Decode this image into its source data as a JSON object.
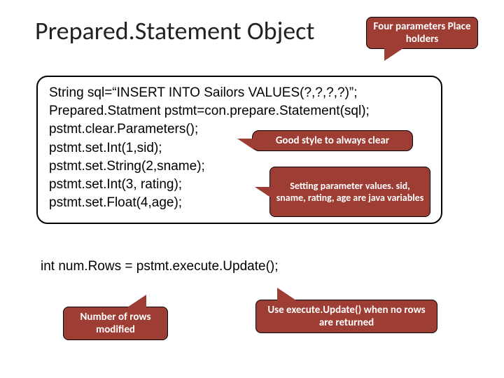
{
  "title": "Prepared.Statement Object",
  "callouts": {
    "params": "Four parameters Place holders",
    "clear": "Good style to always clear",
    "setting": "Setting parameter values. sid, sname, rating, age are java variables",
    "numrows": "Number of rows modified",
    "exec": "Use execute.Update() when no rows are returned"
  },
  "code": {
    "l1": "String sql=“INSERT INTO Sailors VALUES(?,?,?,?)”;",
    "l2": "Prepared.Statment pstmt=con.prepare.Statement(sql);",
    "l3": "pstmt.clear.Parameters();",
    "l4": "pstmt.set.Int(1,sid);",
    "l5": "pstmt.set.String(2,sname);",
    "l6": "pstmt.set.Int(3, rating);",
    "l7": "pstmt.set.Float(4,age);"
  },
  "lone_line": "int num.Rows = pstmt.execute.Update();"
}
